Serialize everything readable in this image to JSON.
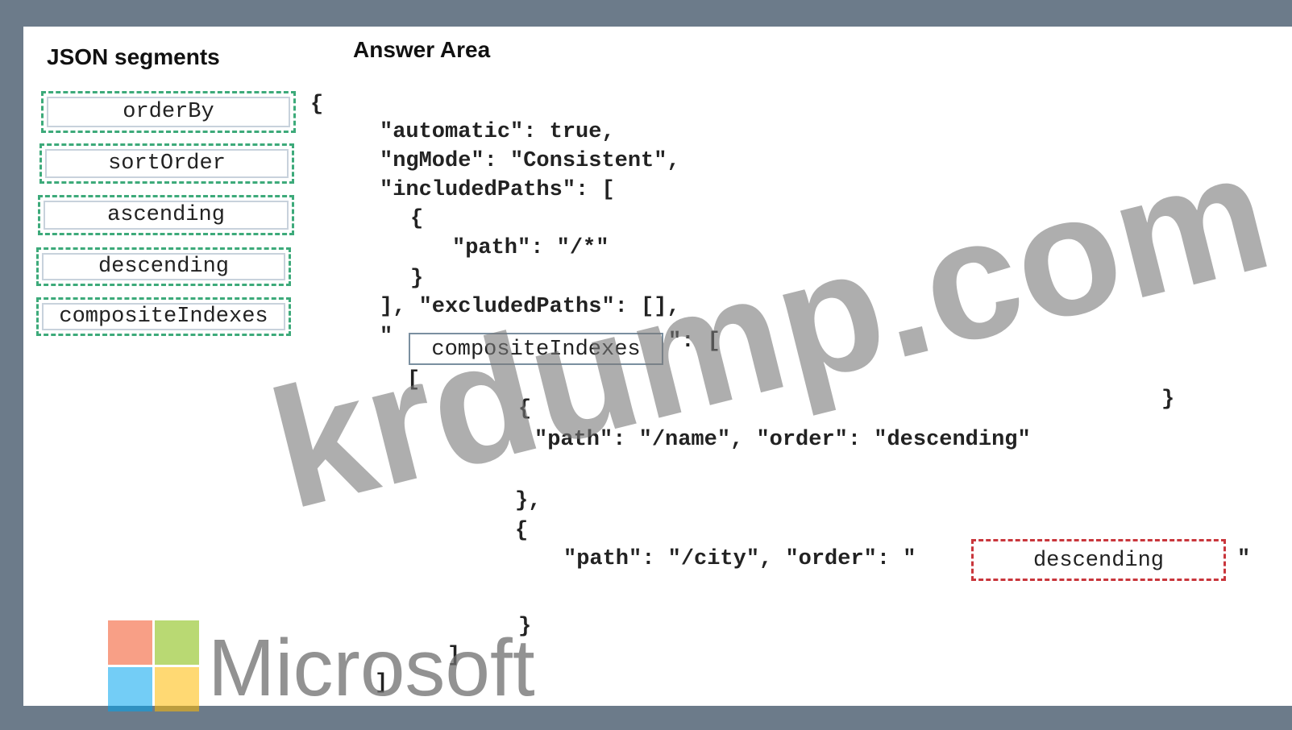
{
  "headings": {
    "left": "JSON segments",
    "right": "Answer Area"
  },
  "segments": [
    "orderBy",
    "sortOrder",
    "ascending",
    "descending",
    "compositeIndexes"
  ],
  "code": {
    "open_brace": "{",
    "l1": "\"automatic\": true,",
    "l2": "\"ngMode\": \"Consistent\",",
    "l3": "\"includedPaths\": [",
    "l4": "{",
    "l5": "\"path\": \"/*\"",
    "l6": "}",
    "l7": "], \"excludedPaths\": [],",
    "l8_quote": "\"",
    "l8_after": "\": [",
    "l9": "[",
    "l10": "{",
    "l11": "\"path\": \"/name\", \"order\": \"descending\"",
    "l12": "},",
    "l13": "{",
    "l14_before": "\"path\": \"/city\", \"order\": \"",
    "l14_after": "\"",
    "l15": "}",
    "l16": "]",
    "l17": "]",
    "far_brace": "}"
  },
  "slots": {
    "slot1": "compositeIndexes",
    "slot2": "descending"
  },
  "watermark": "krdump.com",
  "logo": {
    "text": "Microsoft",
    "colors": [
      "#f25022",
      "#7fba00",
      "#00a4ef",
      "#ffb900"
    ]
  }
}
